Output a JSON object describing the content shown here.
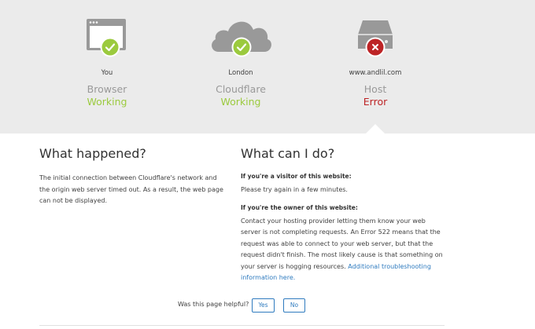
{
  "nodes": [
    {
      "place": "You",
      "name": "Browser",
      "status": "Working"
    },
    {
      "place": "London",
      "name": "Cloudflare",
      "status": "Working"
    },
    {
      "place": "www.andlil.com",
      "name": "Host",
      "status": "Error"
    }
  ],
  "what_happened": {
    "title": "What happened?",
    "text": "The initial connection between Cloudflare's network and the origin web server timed out. As a result, the web page can not be displayed."
  },
  "what_can_i_do": {
    "title": "What can I do?",
    "visitor_heading": "If you're a visitor of this website:",
    "visitor_text": "Please try again in a few minutes.",
    "owner_heading": "If you're the owner of this website:",
    "owner_text": "Contact your hosting provider letting them know your web server is not completing requests. An Error 522 means that the request was able to connect to your web server, but that the request didn't finish. The most likely cause is that something on your server is hogging resources.",
    "owner_link": "Additional troubleshooting information here."
  },
  "feedback": {
    "question": "Was this page helpful?",
    "yes": "Yes",
    "no": "No"
  },
  "colors": {
    "ok": "#9bca3e",
    "error": "#bd2426",
    "link": "#2f7bbf",
    "icon_gray": "#999999"
  }
}
